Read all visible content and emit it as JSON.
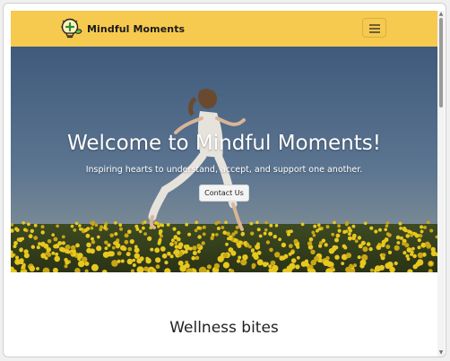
{
  "navbar": {
    "brand_name": "Mindful Moments",
    "logo_icon": "lightbulb-leaf-icon",
    "menu_icon": "hamburger-menu-icon",
    "background_color": "#f6c94f"
  },
  "hero": {
    "title": "Welcome to Mindful Moments!",
    "subtitle": "Inspiring hearts to understand, accept, and support one another.",
    "button_label": "Contact Us",
    "image_subject": "girl running through a field of yellow flowers"
  },
  "section": {
    "title": "Wellness bites"
  },
  "scrollbar": {
    "up_arrow": "▲",
    "down_arrow": "▼"
  }
}
